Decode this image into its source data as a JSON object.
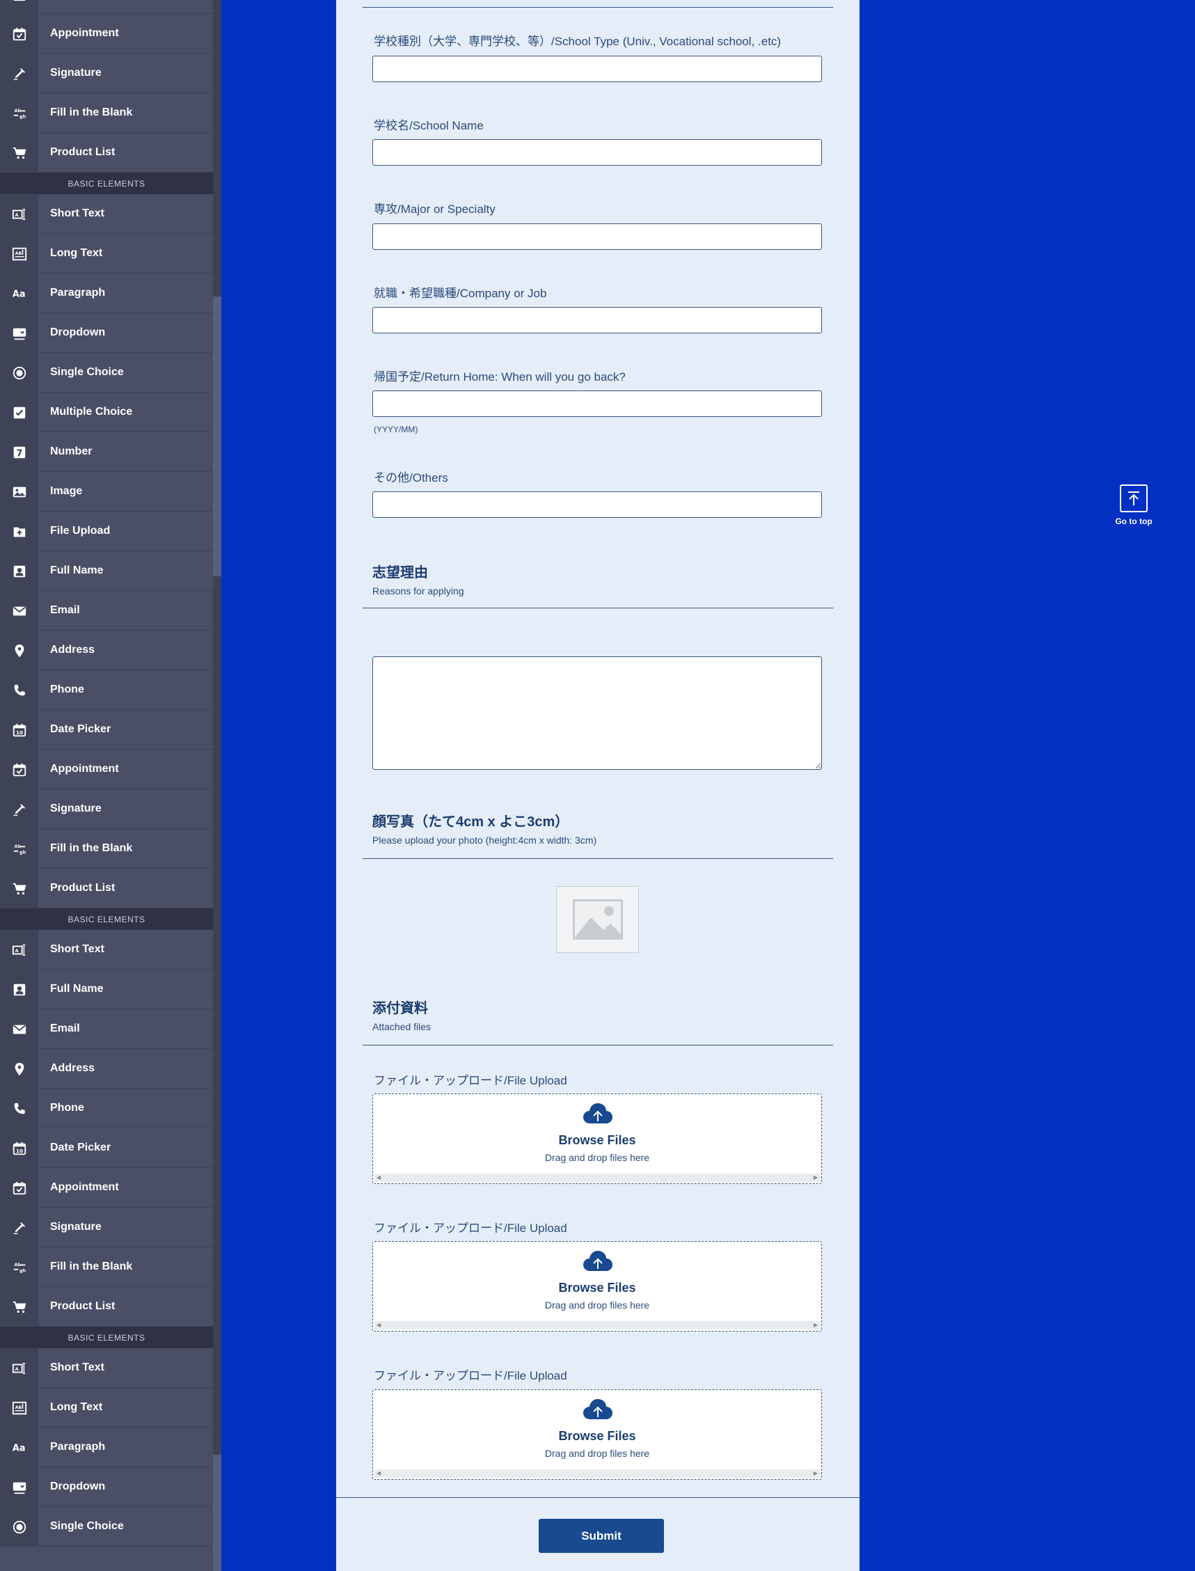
{
  "sidebar": {
    "section_label": "BASIC ELEMENTS",
    "items": [
      {
        "label": "Date Picker",
        "icon": "calendar-icon"
      },
      {
        "label": "Appointment",
        "icon": "calendar-check-icon"
      },
      {
        "label": "Signature",
        "icon": "pen-icon"
      },
      {
        "label": "Fill in the Blank",
        "icon": "fill-blank-icon"
      },
      {
        "label": "Product List",
        "icon": "cart-icon"
      },
      {
        "section": "BASIC ELEMENTS"
      },
      {
        "label": "Short Text",
        "icon": "short-text-icon"
      },
      {
        "label": "Long Text",
        "icon": "long-text-icon"
      },
      {
        "label": "Paragraph",
        "icon": "paragraph-icon"
      },
      {
        "label": "Dropdown",
        "icon": "dropdown-icon"
      },
      {
        "label": "Single Choice",
        "icon": "radio-icon"
      },
      {
        "label": "Multiple Choice",
        "icon": "checkbox-icon"
      },
      {
        "label": "Number",
        "icon": "number-icon"
      },
      {
        "label": "Image",
        "icon": "image-icon"
      },
      {
        "label": "File Upload",
        "icon": "file-upload-icon"
      },
      {
        "label": "Full Name",
        "icon": "person-icon"
      },
      {
        "label": "Email",
        "icon": "envelope-icon"
      },
      {
        "label": "Address",
        "icon": "location-pin-icon"
      },
      {
        "label": "Phone",
        "icon": "phone-icon"
      },
      {
        "label": "Date Picker",
        "icon": "calendar-icon"
      },
      {
        "label": "Appointment",
        "icon": "calendar-check-icon"
      },
      {
        "label": "Signature",
        "icon": "pen-icon"
      },
      {
        "label": "Fill in the Blank",
        "icon": "fill-blank-icon"
      },
      {
        "label": "Product List",
        "icon": "cart-icon"
      },
      {
        "section": "BASIC ELEMENTS"
      },
      {
        "label": "Short Text",
        "icon": "short-text-icon"
      },
      {
        "label": "Full Name",
        "icon": "person-icon"
      },
      {
        "label": "Email",
        "icon": "envelope-icon"
      },
      {
        "label": "Address",
        "icon": "location-pin-icon"
      },
      {
        "label": "Phone",
        "icon": "phone-icon"
      },
      {
        "label": "Date Picker",
        "icon": "calendar-icon"
      },
      {
        "label": "Appointment",
        "icon": "calendar-check-icon"
      },
      {
        "label": "Signature",
        "icon": "pen-icon"
      },
      {
        "label": "Fill in the Blank",
        "icon": "fill-blank-icon"
      },
      {
        "label": "Product List",
        "icon": "cart-icon"
      },
      {
        "section": "BASIC ELEMENTS"
      },
      {
        "label": "Short Text",
        "icon": "short-text-icon"
      },
      {
        "label": "Long Text",
        "icon": "long-text-icon"
      },
      {
        "label": "Paragraph",
        "icon": "paragraph-icon"
      },
      {
        "label": "Dropdown",
        "icon": "dropdown-icon"
      },
      {
        "label": "Single Choice",
        "icon": "radio-icon"
      }
    ]
  },
  "form": {
    "fields": {
      "school_type": {
        "label": "学校種別（大学、専門学校、等）/School Type (Univ., Vocational school, .etc)",
        "value": ""
      },
      "school_name": {
        "label": "学校名/School Name",
        "value": ""
      },
      "major": {
        "label": "専攻/Major or Specialty",
        "value": ""
      },
      "company_job": {
        "label": "就職・希望職種/Company or Job",
        "value": ""
      },
      "return_home": {
        "label": "帰国予定/Return Home: When will you go back?",
        "value": "",
        "hint": "(YYYY/MM)"
      },
      "others": {
        "label": "その他/Others",
        "value": ""
      }
    },
    "reasons": {
      "title": "志望理由",
      "subtitle": "Reasons for applying",
      "value": ""
    },
    "photo": {
      "title": "顔写真（たて4cm x よこ3cm）",
      "subtitle": "Please upload your photo (height:4cm x width: 3cm)"
    },
    "attachments": {
      "title": "添付資料",
      "subtitle": "Attached files"
    },
    "uploads": [
      {
        "label": "ファイル・アップロード/File Upload",
        "button": "Browse Files",
        "hint": "Drag and drop files here"
      },
      {
        "label": "ファイル・アップロード/File Upload",
        "button": "Browse Files",
        "hint": "Drag and drop files here"
      },
      {
        "label": "ファイル・アップロード/File Upload",
        "button": "Browse Files",
        "hint": "Drag and drop files here"
      }
    ],
    "submit_label": "Submit"
  },
  "go_to_top": {
    "label": "Go to top"
  },
  "colors": {
    "background": "#0230c2",
    "form_bg": "#e5edf8",
    "sidebar": "#4a4f66",
    "accent": "#174a8f"
  }
}
